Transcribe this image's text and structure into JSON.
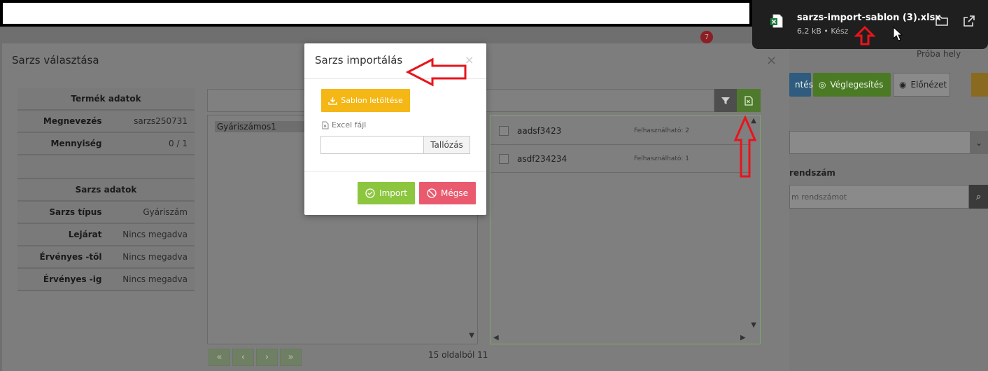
{
  "download": {
    "filename": "sarzs-import-sablon (3).xlsx",
    "meta": "6,2 kB • Kész"
  },
  "background": {
    "badge_count": "7",
    "proba_text": "Próba hely",
    "btn_partial": "ntés",
    "btn_finalize": "Véglegesítés",
    "btn_preview": "Előnézet",
    "label_plate": "rendszám",
    "plate_placeholder": "m rendszámot"
  },
  "modal": {
    "title": "Sarzs választása",
    "product_header": "Termék adatok",
    "product_rows": [
      {
        "label": "Megnevezés",
        "value": "sarzs250731"
      },
      {
        "label": "Mennyiség",
        "value": "0 / 1"
      }
    ],
    "batch_header": "Sarzs adatok",
    "batch_rows": [
      {
        "label": "Sarzs típus",
        "value": "Gyáriszám"
      },
      {
        "label": "Lejárat",
        "value": "Nincs megadva"
      },
      {
        "label": "Érvényes -től",
        "value": "Nincs megadva"
      },
      {
        "label": "Érvényes -ig",
        "value": "Nincs megadva"
      }
    ],
    "left_list_item": "Gyáriszámos1",
    "right_list": [
      {
        "name": "aadsf3423",
        "available": "Felhasználható: 2"
      },
      {
        "name": "asdf234234",
        "available": "Felhasználható: 1"
      }
    ],
    "pager_text": "15 oldalból 11"
  },
  "import_dialog": {
    "title": "Sarzs importálás",
    "template_button": "Sablon letöltése",
    "file_label": "Excel fájl",
    "file_value": "",
    "browse_button": "Tallózás",
    "import_button": "Import",
    "cancel_button": "Mégse"
  },
  "colors": {
    "template_btn": "#f4b716",
    "import_btn": "#8cc63f",
    "cancel_btn": "#ea5a6e",
    "annotation_arrow": "#e8141c"
  }
}
